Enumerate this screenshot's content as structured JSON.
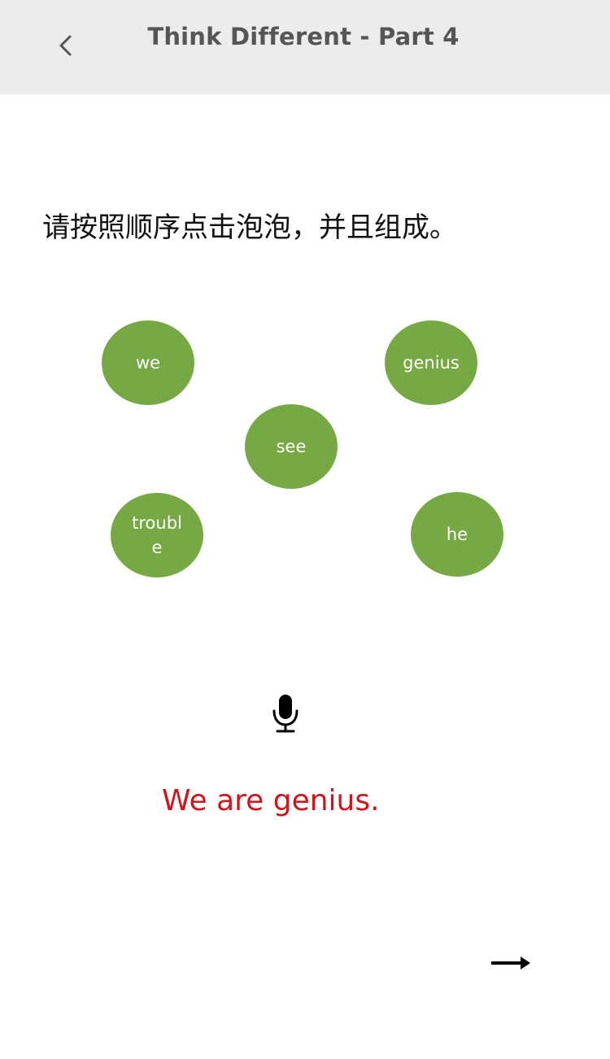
{
  "header": {
    "title": "Think Different - Part 4",
    "back_icon": "chevron-left-icon"
  },
  "instruction": "请按照顺序点击泡泡，并且组成。",
  "bubbles": [
    {
      "label": "we"
    },
    {
      "label": "genius"
    },
    {
      "label": "see"
    },
    {
      "label": "trouble"
    },
    {
      "label": "he"
    }
  ],
  "bubble_color": "#76a844",
  "mic_icon": "microphone-icon",
  "answer": {
    "text": "We are genius.",
    "color": "#d0141e"
  },
  "next_icon": "arrow-right-icon"
}
